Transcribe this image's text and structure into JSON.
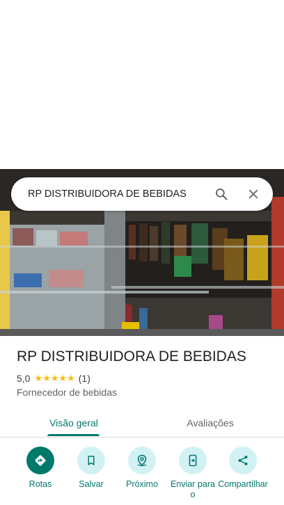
{
  "search": {
    "query": "RP DISTRIBUIDORA DE BEBIDAS"
  },
  "place": {
    "name": "RP DISTRIBUIDORA DE BEBIDAS",
    "rating": "5,0",
    "stars": "★★★★★",
    "review_count": "(1)",
    "category": "Fornecedor de bebidas"
  },
  "tabs": [
    {
      "label": "Visão geral",
      "selected": true
    },
    {
      "label": "Avaliações",
      "selected": false
    }
  ],
  "actions": [
    {
      "label": "Rotas",
      "icon": "directions-icon"
    },
    {
      "label": "Salvar",
      "icon": "bookmark-icon"
    },
    {
      "label": "Próximo",
      "icon": "nearby-icon"
    },
    {
      "label": "Enviar para o",
      "icon": "send-to-phone-icon"
    },
    {
      "label": "Compartilhar",
      "icon": "share-icon"
    }
  ],
  "colors": {
    "accent": "#00796b",
    "action_bg": "#d2f1f4",
    "star": "#fbbc04"
  }
}
